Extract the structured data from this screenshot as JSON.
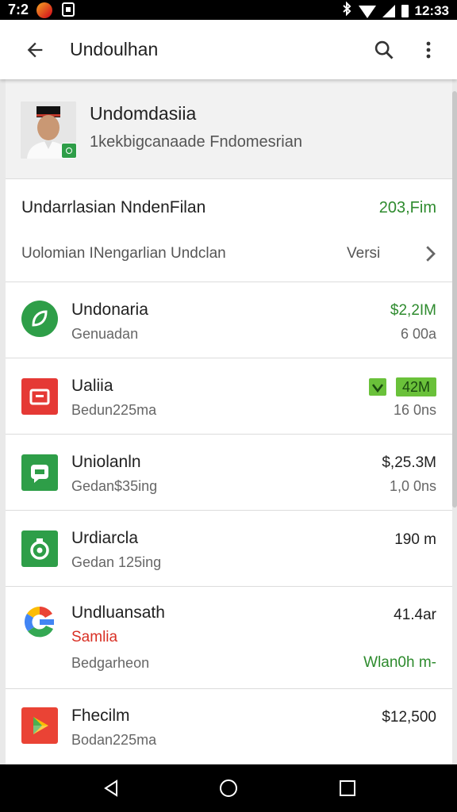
{
  "status_bar": {
    "time": "7:2",
    "clock": "12:33",
    "icons": [
      "app-notification-icon",
      "square-notification-icon",
      "bluetooth-icon",
      "wifi-icon",
      "signal-icon",
      "battery-icon"
    ]
  },
  "app_bar": {
    "title": "Undoulhan",
    "back_icon": "arrow-back-icon",
    "search_icon": "search-icon",
    "more_icon": "more-vert-icon"
  },
  "profile": {
    "name": "Undomdasiia",
    "subtitle": "1kekbigcanaade Fndomesrian"
  },
  "summary": {
    "title": "Undarrlasian NndenFilan",
    "value": "203,Fim",
    "subtitle": "Uolomian INengarlian Undclan",
    "action_label": "Versi"
  },
  "items": [
    {
      "name": "Undonaria",
      "sub": "Genuadan",
      "price": "$2,2IM",
      "size": "6 00a",
      "icon": "leaf-icon",
      "color": "#2e9e48"
    },
    {
      "name": "Ualiia",
      "sub": "Bedun225ma",
      "price": "42M",
      "size": "16 0ns",
      "icon": "briefcase-icon",
      "color": "#e53935",
      "price_badge": true
    },
    {
      "name": "Uniolanln",
      "sub": "Gedan$35ing",
      "price": "$,25.3M",
      "size": "1,0 0ns",
      "icon": "chat-icon",
      "color": "#2e9e48"
    },
    {
      "name": "Urdiarcla",
      "sub": "Gedan 125ing",
      "price": "",
      "size": "190 m",
      "icon": "camera-icon",
      "color": "#2e9e48"
    },
    {
      "name": "Undluansath",
      "sub_red": "Samlia",
      "sub": "Bedgarheon",
      "price": "41.4ar",
      "action": "Wlan0h m-",
      "icon": "google-g-icon",
      "color": "#4285f4"
    },
    {
      "name": "Fhecilm",
      "sub": "Bodan225ma",
      "price": "$12,500",
      "size": "",
      "icon": "play-icon",
      "color": "#ea4335"
    }
  ],
  "nav_bar": {
    "back_icon": "nav-back-icon",
    "home_icon": "nav-home-icon",
    "recents_icon": "nav-recents-icon"
  }
}
